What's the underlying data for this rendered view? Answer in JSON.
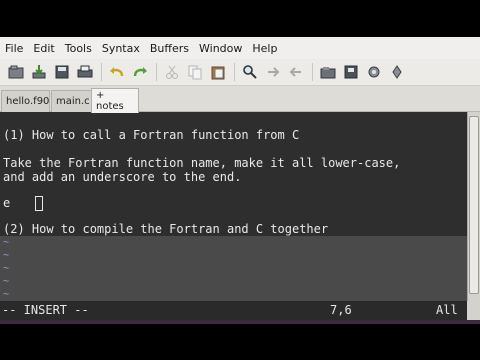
{
  "menubar": {
    "items": [
      "File",
      "Edit",
      "Tools",
      "Syntax",
      "Buffers",
      "Window",
      "Help"
    ]
  },
  "toolbar": {
    "icons": [
      "open-icon",
      "save-download-icon",
      "save-icon",
      "print-icon",
      "undo-icon",
      "redo-icon",
      "cut-icon",
      "copy-icon",
      "paste-icon",
      "find-replace-icon",
      "find-next-icon",
      "find-prev-icon",
      "load-session-icon",
      "save-session-icon",
      "run-script-icon",
      "make-icon"
    ]
  },
  "tabs": [
    {
      "label": "hello.f90"
    },
    {
      "label": "main.c"
    },
    {
      "label": "+ notes"
    }
  ],
  "editor": {
    "line1": "(1) How to call a Fortran function from C",
    "line3": "Take the Fortran function name, make it all lower-case,",
    "line4": "and add an underscore to the end.",
    "line6": "e",
    "line8": "(2) How to compile the Fortran and C together",
    "tildes": [
      "~",
      "~",
      "~",
      "~",
      "~"
    ]
  },
  "status": {
    "mode": "-- INSERT --",
    "position": "7,6",
    "scroll": "All"
  },
  "colors": {
    "editor_bg": "#2e2e2e",
    "editor_fg": "#e6e6e6",
    "tilde": "#9aa3e0"
  }
}
